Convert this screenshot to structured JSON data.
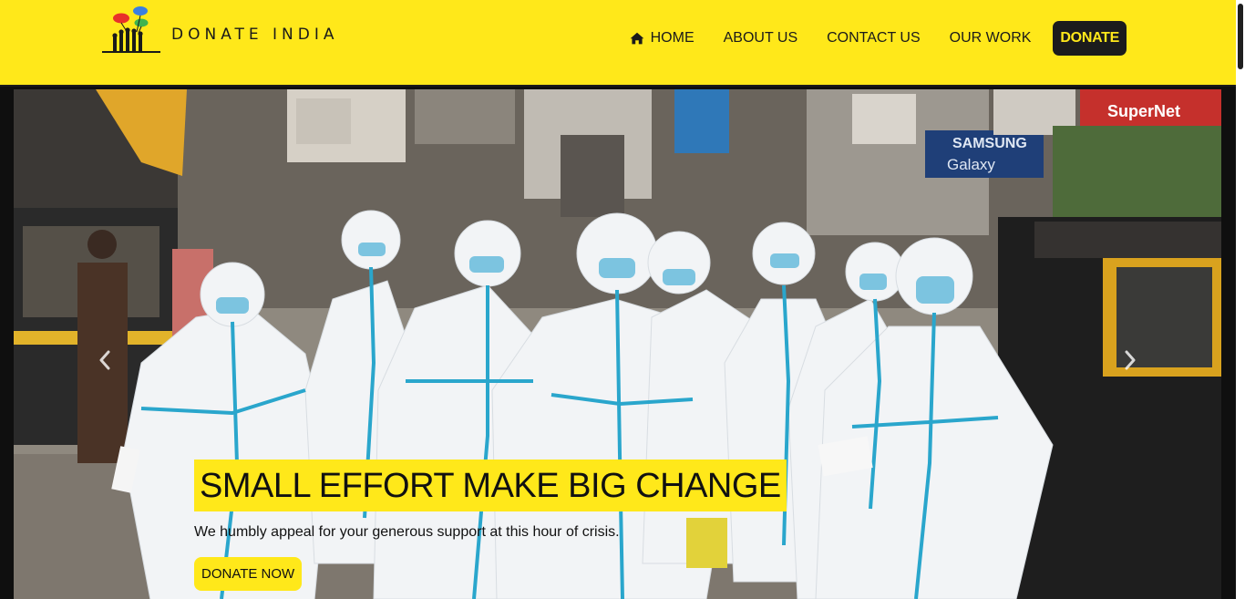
{
  "brand": {
    "name": "DONATE INDIA",
    "logo_icon": "hands-with-balloons-logo",
    "colors": {
      "balloon_red": "#e8312a",
      "balloon_blue": "#3b7fe0",
      "balloon_green": "#3fb34f",
      "hands": "#1a1a1a"
    }
  },
  "nav": {
    "items": [
      {
        "label": "HOME",
        "icon": "home-icon"
      },
      {
        "label": "ABOUT US"
      },
      {
        "label": "CONTACT US"
      },
      {
        "label": "OUR WORK"
      }
    ],
    "donate_label": "DONATE"
  },
  "hero": {
    "headline": "SMALL EFFORT MAKE BIG CHANGE",
    "subtitle": "We humbly appeal for your generous support at this hour of crisis.",
    "cta_label": "DONATE NOW",
    "prev_icon": "chevron-left-icon",
    "next_icon": "chevron-right-icon",
    "photo": "health workers in PPE suits walking down a market street",
    "photo_signs": [
      "SuperNet",
      "SAMSUNG",
      "Galaxy"
    ]
  },
  "theme": {
    "accent": "#ffe81a",
    "dark": "#1c1c1c"
  }
}
